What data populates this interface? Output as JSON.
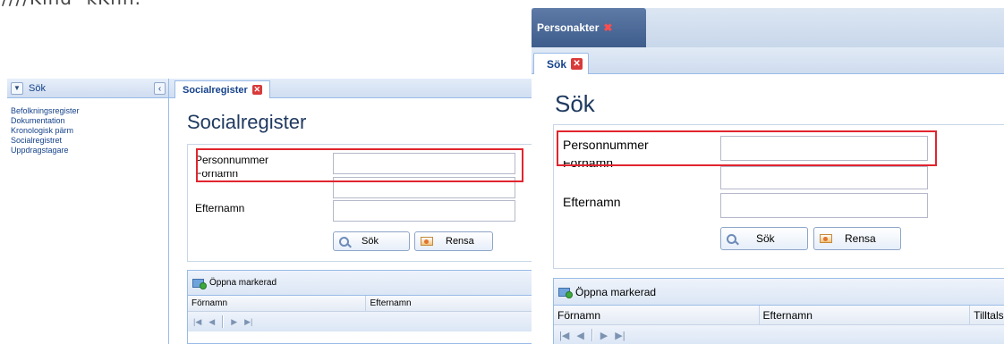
{
  "top_text": "////Kind- kKnn.",
  "left": {
    "sidebar": {
      "title": "Sök",
      "items": [
        {
          "label": "Befolkningsregister"
        },
        {
          "label": "Dokumentation"
        },
        {
          "label": "Kronologisk pärm"
        },
        {
          "label": "Socialregistret"
        },
        {
          "label": "Uppdragstagare"
        }
      ]
    },
    "tab": {
      "label": "Socialregister"
    },
    "heading": "Socialregister",
    "form": {
      "personnummer_label": "Personnummer",
      "fornamn_label": "Förnamn",
      "efternamn_label": "Efternamn",
      "search_label": "Sök",
      "reset_label": "Rensa"
    },
    "grid": {
      "open_label": "Öppna markerad",
      "columns": [
        "Förnamn",
        "Efternamn"
      ]
    }
  },
  "right": {
    "top_tab": {
      "label": "Personakter"
    },
    "sub_tab": {
      "label": "Sök"
    },
    "heading": "Sök",
    "form": {
      "personnummer_label": "Personnummer",
      "fornamn_label": "Förnamn",
      "efternamn_label": "Efternamn",
      "search_label": "Sök",
      "reset_label": "Rensa"
    },
    "grid": {
      "open_label": "Öppna markerad",
      "columns": [
        "Förnamn",
        "Efternamn",
        "Tilltals"
      ]
    }
  },
  "colors": {
    "highlight": "#e1252e",
    "heading": "#1f3a60",
    "tab_text": "#15428b",
    "border": "#99bbe8"
  }
}
